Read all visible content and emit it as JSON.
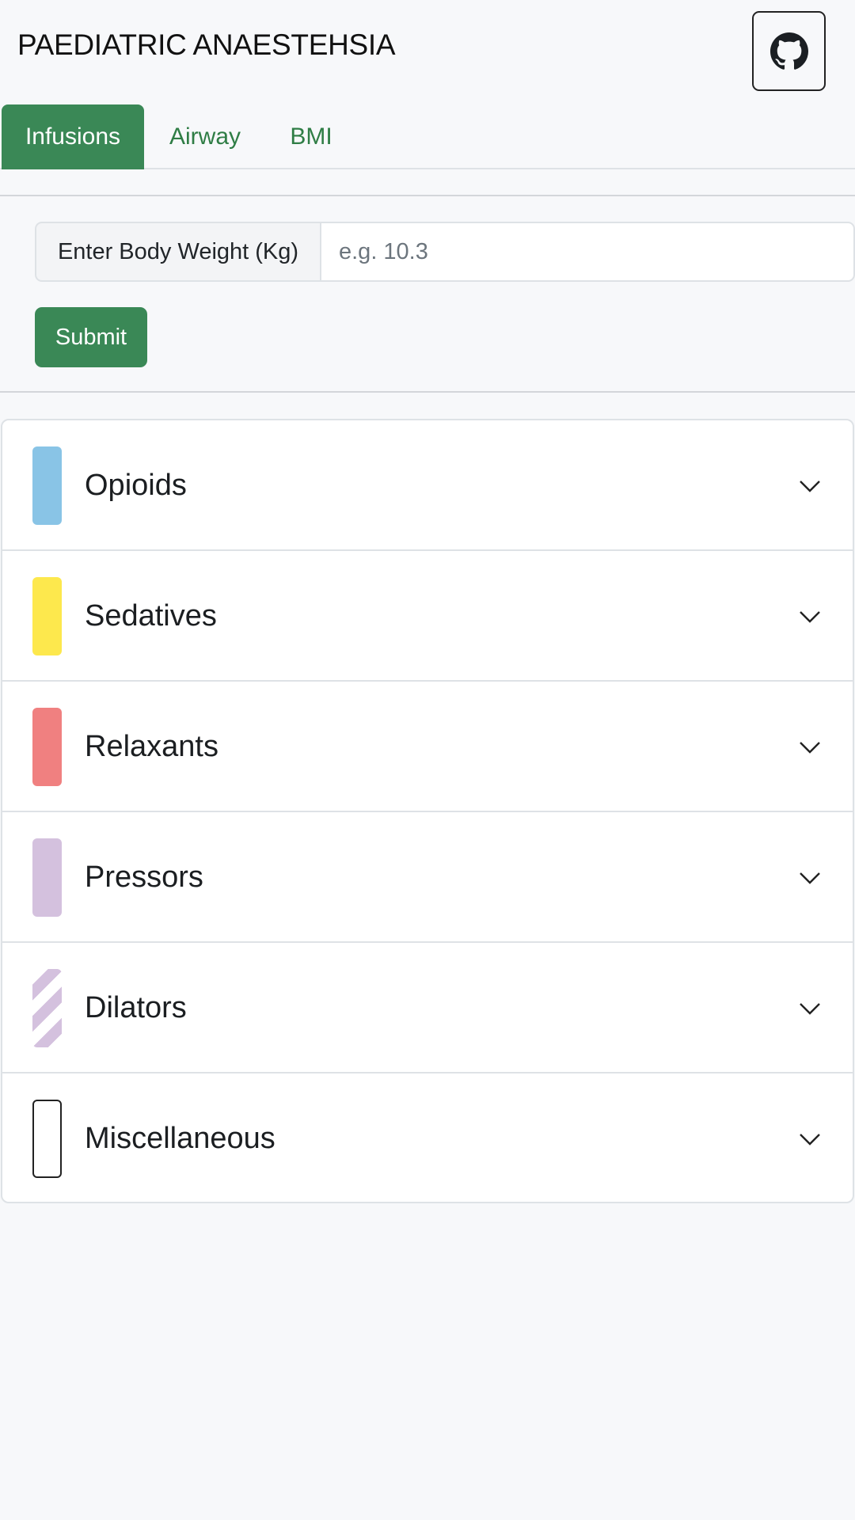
{
  "app": {
    "title": "PAEDIATRIC ANAESTEHSIA",
    "github_icon": "github-icon"
  },
  "tabs": [
    {
      "label": "Infusions",
      "active": true
    },
    {
      "label": "Airway",
      "active": false
    },
    {
      "label": "BMI",
      "active": false
    }
  ],
  "form": {
    "weight_label": "Enter Body Weight (Kg)",
    "weight_placeholder": "e.g. 10.3",
    "weight_value": "",
    "submit_label": "Submit"
  },
  "categories": [
    {
      "label": "Opioids",
      "color": "#89c4e6",
      "pattern": "solid"
    },
    {
      "label": "Sedatives",
      "color": "#fde84d",
      "pattern": "solid"
    },
    {
      "label": "Relaxants",
      "color": "#f08080",
      "pattern": "solid"
    },
    {
      "label": "Pressors",
      "color": "#d4c1de",
      "pattern": "solid"
    },
    {
      "label": "Dilators",
      "color": "#d4c1de",
      "pattern": "striped"
    },
    {
      "label": "Miscellaneous",
      "color": "#ffffff",
      "pattern": "outline"
    }
  ],
  "colors": {
    "accent": "#3a8856",
    "tab_text": "#2f7d45",
    "background": "#f7f8fa"
  }
}
